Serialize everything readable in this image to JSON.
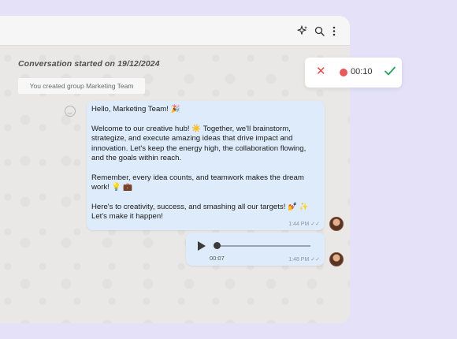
{
  "conversation": {
    "started_label": "Conversation started on 19/12/2024",
    "system_message": "You created group Marketing Team"
  },
  "messages": [
    {
      "type": "text",
      "text": "Hello, Marketing Team! 🎉\n\nWelcome to our creative hub! ☀️ Together, we'll brainstorm, strategize, and execute amazing ideas that drive impact and innovation. Let's keep the energy high, the collaboration flowing, and the goals within reach.\n\nRemember, every idea counts, and teamwork makes the dream work! 💡 💼\n\nHere's to creativity, success, and smashing all our targets! 💅 ✨\nLet's make it happen!",
      "time": "1:44 PM"
    },
    {
      "type": "voice",
      "duration": "00:07",
      "time": "1:48 PM",
      "progress": 0.0
    }
  ],
  "recorder": {
    "elapsed": "00:10",
    "cancel_icon": "close-icon",
    "send_icon": "check-icon",
    "record_color": "#e85a5a"
  },
  "topbar": {
    "icons": [
      "sparkle-icon",
      "search-icon",
      "more-vertical-icon"
    ]
  },
  "colors": {
    "background": "#e4e1f9",
    "bubble": "#ddebfa",
    "cancel": "#e44848",
    "send": "#27a060"
  }
}
